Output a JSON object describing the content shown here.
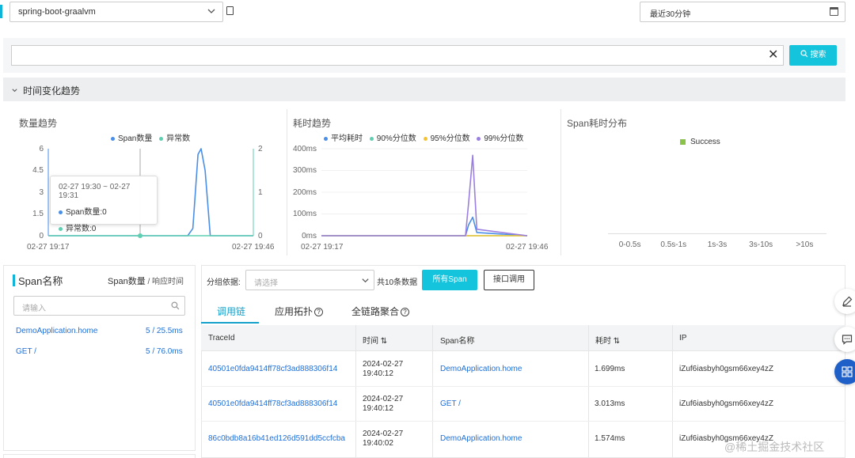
{
  "header": {
    "app_value": "spring-boot-graalvm",
    "time_range": "最近30分钟"
  },
  "search": {
    "value": "",
    "clear_glyph": "✕",
    "button_label": "搜索"
  },
  "trend_section": {
    "title": "时间变化趋势"
  },
  "charts": {
    "count_title": "数量趋势",
    "duration_title": "耗时趋势",
    "dist_title": "Span耗时分布",
    "count_legend": [
      "Span数量",
      "异常数"
    ],
    "duration_legend": [
      "平均耗时",
      "90%分位数",
      "95%分位数",
      "99%分位数"
    ],
    "dist_legend": [
      "Success"
    ],
    "tooltip": {
      "time": "02-27 19:30 ~ 02-27 19:31",
      "line1": "Span数量:0",
      "line2": "异常数:0"
    }
  },
  "chart_data": [
    {
      "type": "line",
      "title": "数量趋势",
      "x_start": "02-27 19:17",
      "x_end": "02-27 19:46",
      "y_left_ticks": [
        "6",
        "4.5",
        "3",
        "1.5",
        "0"
      ],
      "y_right_ticks": [
        "2",
        "1",
        "0"
      ],
      "ylim_left": [
        0,
        6
      ],
      "ylim_right": [
        0,
        2
      ],
      "series": [
        {
          "name": "Span数量",
          "color": "#4a8ee8",
          "axis": "left",
          "x_frac": [
            0,
            0.68,
            0.705,
            0.73,
            0.745,
            0.765,
            0.79,
            1
          ],
          "values": [
            0,
            0,
            0.5,
            5.6,
            6,
            4.5,
            0,
            0
          ]
        },
        {
          "name": "异常数",
          "color": "#5ecfb0",
          "axis": "right",
          "x_frac": [
            0,
            1
          ],
          "values": [
            0,
            0
          ]
        }
      ]
    },
    {
      "type": "line",
      "title": "耗时趋势",
      "x_start": "02-27 19:17",
      "x_end": "02-27 19:46",
      "y_ticks": [
        "400ms",
        "300ms",
        "200ms",
        "100ms",
        "0ms"
      ],
      "ylim": [
        0,
        400
      ],
      "series": [
        {
          "name": "平均耗时",
          "color": "#4a8ee8",
          "x_frac": [
            0,
            0.7,
            0.715,
            0.735,
            0.755,
            1
          ],
          "values": [
            0,
            0,
            50,
            85,
            15,
            0
          ]
        },
        {
          "name": "90%分位数",
          "color": "#5ecfb0",
          "x_frac": [
            0,
            1
          ],
          "values": [
            0,
            0
          ]
        },
        {
          "name": "95%分位数",
          "color": "#f5c330",
          "x_frac": [
            0,
            1
          ],
          "values": [
            0,
            0
          ]
        },
        {
          "name": "99%分位数",
          "color": "#9a7fe0",
          "x_frac": [
            0,
            0.7,
            0.715,
            0.735,
            0.755,
            1
          ],
          "values": [
            0,
            0,
            150,
            370,
            30,
            0
          ]
        }
      ]
    },
    {
      "type": "bar",
      "title": "Span耗时分布",
      "categories": [
        "0-0.5s",
        "0.5s-1s",
        "1s-3s",
        "3s-10s",
        ">10s"
      ],
      "series": [
        {
          "name": "Success",
          "color": "#8bc34a",
          "values": [
            0,
            0,
            0,
            0,
            0
          ]
        }
      ]
    }
  ],
  "span_panel": {
    "title": "Span名称",
    "sub_title_main": "Span数量",
    "sub_title_rest": " / 响应时间",
    "search_placeholder": "请输入",
    "items": [
      {
        "name": "DemoApplication.home",
        "stat": "5 / 25.5ms"
      },
      {
        "name": "GET /",
        "stat": "5 / 76.0ms"
      }
    ]
  },
  "trace_panel": {
    "group_label": "分组依据:",
    "group_placeholder": "请选择",
    "total": "共10条数据",
    "btn_all": "所有Span",
    "btn_api": "接口调用",
    "tabs": [
      "调用链",
      "应用拓扑",
      "全链路聚合"
    ],
    "columns": [
      "TraceId",
      "时间",
      "Span名称",
      "耗时",
      "IP"
    ],
    "rows": [
      {
        "trace": "40501e0fda9414ff78cf3ad888306f14",
        "date": "2024-02-27",
        "time": "19:40:12",
        "span": "DemoApplication.home",
        "dur": "1.699ms",
        "ip": "iZuf6iasbyh0gsm66xey4zZ"
      },
      {
        "trace": "40501e0fda9414ff78cf3ad888306f14",
        "date": "2024-02-27",
        "time": "19:40:12",
        "span": "GET /",
        "dur": "3.013ms",
        "ip": "iZuf6iasbyh0gsm66xey4zZ"
      },
      {
        "trace": "86c0bdb8a16b41ed126d591dd5ccfcba",
        "date": "2024-02-27",
        "time": "19:40:02",
        "span": "DemoApplication.home",
        "dur": "1.574ms",
        "ip": "iZuf6iasbyh0gsm66xey4zZ"
      }
    ]
  },
  "watermark": "@稀土掘金技术社区"
}
